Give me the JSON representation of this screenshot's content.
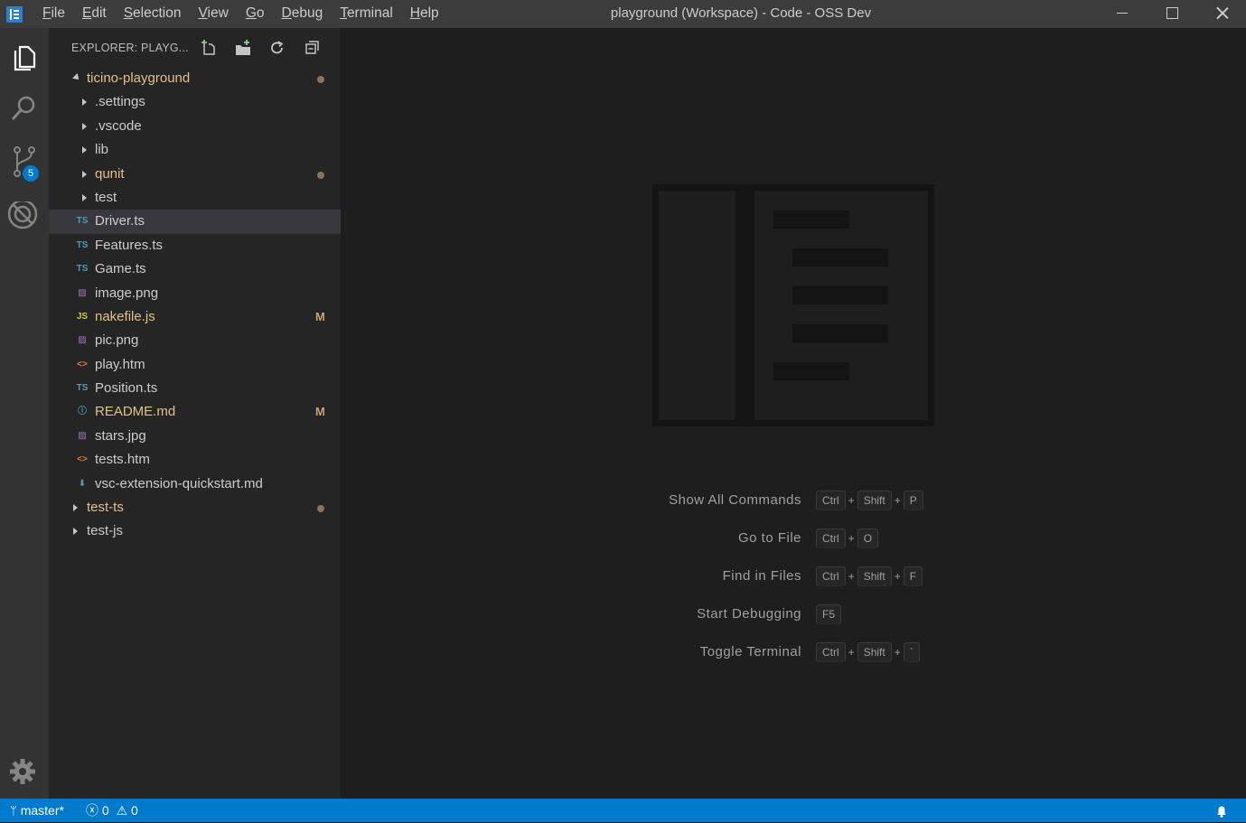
{
  "window": {
    "title": "playground (Workspace) - Code - OSS Dev"
  },
  "menu": [
    {
      "u": "F",
      "rest": "ile"
    },
    {
      "u": "E",
      "rest": "dit"
    },
    {
      "u": "S",
      "rest": "election"
    },
    {
      "u": "V",
      "rest": "iew"
    },
    {
      "u": "G",
      "rest": "o"
    },
    {
      "u": "D",
      "rest": "ebug"
    },
    {
      "u": "T",
      "rest": "erminal"
    },
    {
      "u": "H",
      "rest": "elp"
    }
  ],
  "activity": {
    "scm_badge": "5",
    "icons": [
      "files-icon",
      "search-icon",
      "source-control-icon",
      "extensions-icon",
      "gear-icon"
    ]
  },
  "explorer": {
    "header": "EXPLORER: PLAYG...",
    "root": "ticino-playground",
    "items": [
      {
        "label": ".settings",
        "kind": "folder"
      },
      {
        "label": ".vscode",
        "kind": "folder"
      },
      {
        "label": "lib",
        "kind": "folder"
      },
      {
        "label": "qunit",
        "kind": "folder",
        "status": "dot"
      },
      {
        "label": "test",
        "kind": "folder"
      },
      {
        "label": "Driver.ts",
        "kind": "ts",
        "icon": "TS",
        "selected": true
      },
      {
        "label": "Features.ts",
        "kind": "ts",
        "icon": "TS"
      },
      {
        "label": "Game.ts",
        "kind": "ts",
        "icon": "TS"
      },
      {
        "label": "image.png",
        "kind": "img",
        "icon": "▨"
      },
      {
        "label": "nakefile.js",
        "kind": "js",
        "icon": "JS",
        "status": "M"
      },
      {
        "label": "pic.png",
        "kind": "img",
        "icon": "▨"
      },
      {
        "label": "play.htm",
        "kind": "html",
        "icon": "<>"
      },
      {
        "label": "Position.ts",
        "kind": "ts",
        "icon": "TS"
      },
      {
        "label": "README.md",
        "kind": "info",
        "icon": "ⓘ",
        "status": "M"
      },
      {
        "label": "stars.jpg",
        "kind": "img",
        "icon": "▨"
      },
      {
        "label": "tests.htm",
        "kind": "html",
        "icon": "<>"
      },
      {
        "label": "vsc-extension-quickstart.md",
        "kind": "md",
        "icon": "⬇"
      }
    ],
    "roots_after": [
      {
        "label": "test-ts",
        "status": "dot"
      },
      {
        "label": "test-js"
      }
    ]
  },
  "welcome": {
    "shortcuts": [
      {
        "label": "Show All Commands",
        "keys": [
          "Ctrl",
          "Shift",
          "P"
        ]
      },
      {
        "label": "Go to File",
        "keys": [
          "Ctrl",
          "O"
        ]
      },
      {
        "label": "Find in Files",
        "keys": [
          "Ctrl",
          "Shift",
          "F"
        ]
      },
      {
        "label": "Start Debugging",
        "keys": [
          "F5"
        ]
      },
      {
        "label": "Toggle Terminal",
        "keys": [
          "Ctrl",
          "Shift",
          "`"
        ]
      }
    ]
  },
  "status": {
    "branch": "master*",
    "errors": "0",
    "warnings": "0"
  },
  "colors": {
    "accent": "#007acc",
    "modified": "#e2c08d",
    "sidebar_bg": "#252526",
    "activity_bg": "#333333",
    "titlebar_bg": "#3c3c3c"
  }
}
